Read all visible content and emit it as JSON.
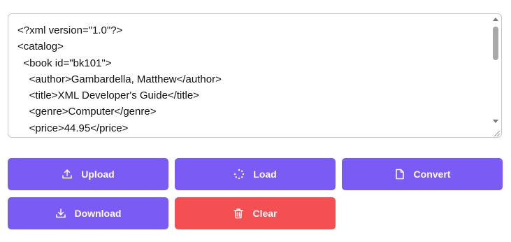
{
  "editor": {
    "lines": [
      "<?xml version=\"1.0\"?>",
      "<catalog>",
      "  <book id=\"bk101\">",
      "    <author>Gambardella, Matthew</author>",
      "    <title>XML Developer's Guide</title>",
      "    <genre>Computer</genre>",
      "    <price>44.95</price>"
    ]
  },
  "buttons": {
    "upload": {
      "label": "Upload",
      "icon": "upload-icon"
    },
    "load": {
      "label": "Load",
      "icon": "spinner-icon"
    },
    "convert": {
      "label": "Convert",
      "icon": "file-icon"
    },
    "download": {
      "label": "Download",
      "icon": "download-icon"
    },
    "clear": {
      "label": "Clear",
      "icon": "trash-icon"
    }
  },
  "colors": {
    "primary": "#7a5cf5",
    "danger": "#f44f53"
  }
}
